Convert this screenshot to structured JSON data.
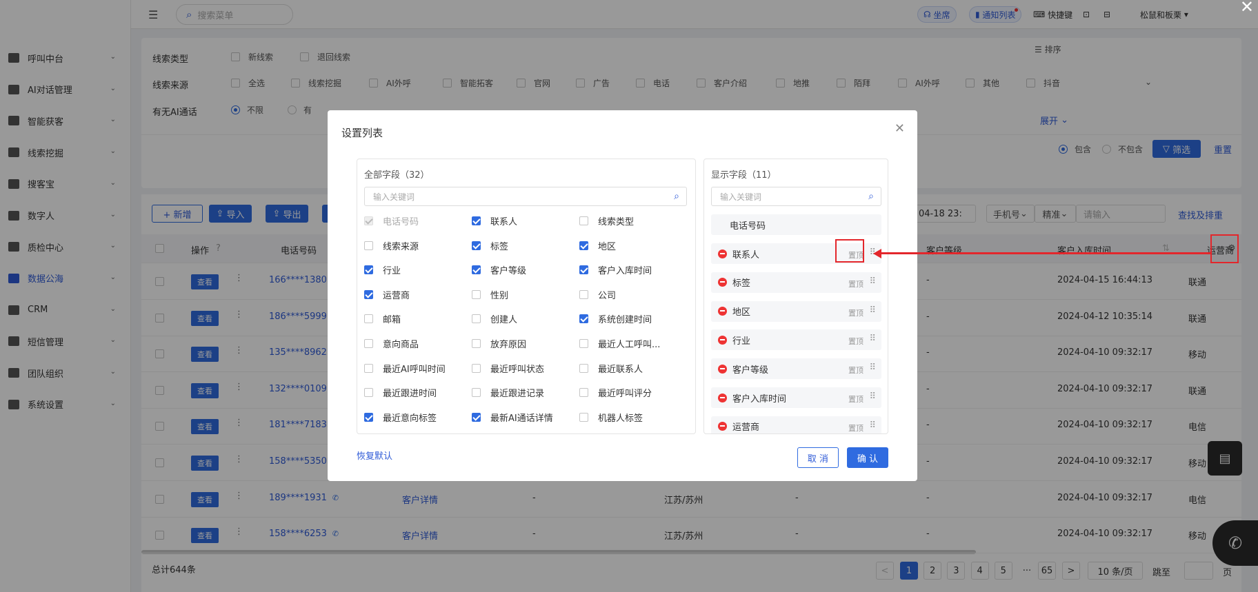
{
  "sidebar": {
    "items": [
      {
        "label": "呼叫中台",
        "icon": "monitor-icon"
      },
      {
        "label": "AI对话管理",
        "icon": "ai-dialog-icon"
      },
      {
        "label": "智能获客",
        "icon": "search-icon"
      },
      {
        "label": "线索挖掘",
        "icon": "target-icon"
      },
      {
        "label": "搜客宝",
        "icon": "search-icon"
      },
      {
        "label": "数字人",
        "icon": "robot-icon"
      },
      {
        "label": "质检中心",
        "icon": "search-icon"
      },
      {
        "label": "数据公海",
        "icon": "chart-icon"
      },
      {
        "label": "CRM",
        "icon": "crm-icon"
      },
      {
        "label": "短信管理",
        "icon": "message-icon"
      },
      {
        "label": "团队组织",
        "icon": "team-icon"
      },
      {
        "label": "系统设置",
        "icon": "settings-icon"
      }
    ],
    "active_index": 7
  },
  "topbar": {
    "search_placeholder": "搜索菜单",
    "seat": "坐席",
    "notify": "通知列表",
    "shortcut": "快捷键",
    "user": "松鼠和板栗"
  },
  "filter": {
    "type_label": "线索类型",
    "type_options": [
      "新线索",
      "退回线索"
    ],
    "source_label": "线索来源",
    "source_options": [
      "全选",
      "线索挖掘",
      "AI外呼",
      "智能拓客",
      "官网",
      "广告",
      "电话",
      "客户介绍",
      "地推",
      "陌拜",
      "AI外呼",
      "其他",
      "抖音"
    ],
    "ai_label": "有无AI通话",
    "ai_options": [
      "不限",
      "有"
    ],
    "sort": "排序",
    "expand": "展开",
    "include": "包含",
    "exclude": "不包含",
    "filter_btn": "筛选",
    "reset": "重置"
  },
  "toolbar": {
    "add": "+ 新增",
    "import": "导入",
    "export": "导出",
    "date_value": "04-18 23:",
    "phone_select": "手机号",
    "match_select": "精准",
    "search_placeholder": "请输入",
    "search_sort": "查找及排重"
  },
  "table": {
    "headers": {
      "op": "操作",
      "phone": "电话号码",
      "level": "客户等级",
      "time": "客户入库时间",
      "carrier": "运营商"
    },
    "view_label": "查看",
    "detail_label": "客户详情",
    "rows": [
      {
        "phone": "166****1380",
        "detail": "",
        "c3": "",
        "region": "",
        "level": "-",
        "time": "2024-04-15 16:44:13",
        "carrier": "联通"
      },
      {
        "phone": "186****5999",
        "detail": "",
        "c3": "",
        "region": "",
        "level": "-",
        "time": "2024-04-12 10:35:14",
        "carrier": "联通"
      },
      {
        "phone": "135****8962",
        "detail": "",
        "c3": "",
        "region": "",
        "level": "-",
        "time": "2024-04-10 09:32:17",
        "carrier": "移动"
      },
      {
        "phone": "132****0109",
        "detail": "",
        "c3": "",
        "region": "",
        "level": "-",
        "time": "2024-04-10 09:32:17",
        "carrier": "联通"
      },
      {
        "phone": "181****7183",
        "detail": "",
        "c3": "",
        "region": "",
        "level": "-",
        "time": "2024-04-10 09:32:17",
        "carrier": "电信"
      },
      {
        "phone": "158****5350",
        "detail": "",
        "c3": "",
        "region": "",
        "level": "-",
        "time": "2024-04-10 09:32:17",
        "carrier": "移动"
      },
      {
        "phone": "189****1931",
        "detail": "客户详情",
        "c3": "-",
        "region": "江苏/苏州",
        "level": "-",
        "time": "2024-04-10 09:32:17",
        "carrier": "电信"
      },
      {
        "phone": "158****6253",
        "detail": "客户详情",
        "c3": "-",
        "region": "江苏/苏州",
        "level": "-",
        "time": "2024-04-10 09:32:17",
        "carrier": "移动"
      }
    ],
    "total": "总计644条"
  },
  "pagination": {
    "pages": [
      "1",
      "2",
      "3",
      "4",
      "5",
      "···",
      "65"
    ],
    "prev": "<",
    "next": ">",
    "size": "10 条/页",
    "jump": "跳至",
    "page_unit": "页"
  },
  "modal": {
    "title": "设置列表",
    "all_title": "全部字段（32）",
    "shown_title": "显示字段（11）",
    "kw_placeholder": "输入关键词",
    "fields": [
      {
        "label": "电话号码",
        "checked": true,
        "disabled": true
      },
      {
        "label": "联系人",
        "checked": true
      },
      {
        "label": "线索类型",
        "checked": false
      },
      {
        "label": "线索来源",
        "checked": false
      },
      {
        "label": "标签",
        "checked": true
      },
      {
        "label": "地区",
        "checked": true
      },
      {
        "label": "行业",
        "checked": true
      },
      {
        "label": "客户等级",
        "checked": true
      },
      {
        "label": "客户入库时间",
        "checked": true
      },
      {
        "label": "运营商",
        "checked": true
      },
      {
        "label": "性别",
        "checked": false
      },
      {
        "label": "公司",
        "checked": false
      },
      {
        "label": "邮箱",
        "checked": false
      },
      {
        "label": "创建人",
        "checked": false
      },
      {
        "label": "系统创建时间",
        "checked": true
      },
      {
        "label": "意向商品",
        "checked": false
      },
      {
        "label": "放弃原因",
        "checked": false
      },
      {
        "label": "最近人工呼叫...",
        "checked": false
      },
      {
        "label": "最近AI呼叫时间",
        "checked": false
      },
      {
        "label": "最近呼叫状态",
        "checked": false
      },
      {
        "label": "最近联系人",
        "checked": false
      },
      {
        "label": "最近跟进时间",
        "checked": false
      },
      {
        "label": "最近跟进记录",
        "checked": false
      },
      {
        "label": "最近呼叫评分",
        "checked": false
      },
      {
        "label": "最近意向标签",
        "checked": true
      },
      {
        "label": "最新AI通话详情",
        "checked": true
      },
      {
        "label": "机器人标签",
        "checked": false
      }
    ],
    "shown_fixed": "电话号码",
    "shown_fields": [
      "联系人",
      "标签",
      "地区",
      "行业",
      "客户等级",
      "客户入库时间",
      "运营商"
    ],
    "pin_label": "置顶",
    "restore": "恢复默认",
    "cancel": "取 消",
    "confirm": "确 认"
  },
  "colors": {
    "accent": "#2f6be0",
    "annotation": "#e3262b"
  }
}
